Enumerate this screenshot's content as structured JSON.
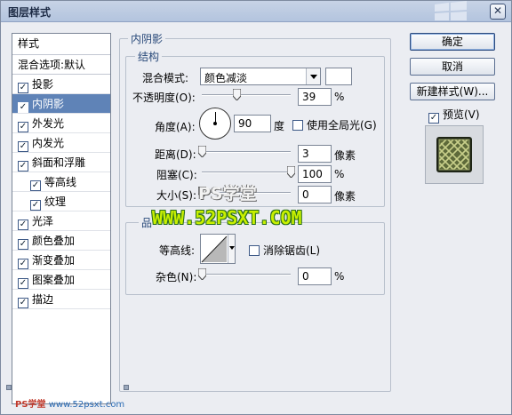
{
  "window": {
    "title": "图层样式"
  },
  "style_list": {
    "header": "样式",
    "blend_options": "混合选项:默认",
    "items": [
      {
        "label": "投影",
        "checked": true,
        "selected": false,
        "indent": false
      },
      {
        "label": "内阴影",
        "checked": true,
        "selected": true,
        "indent": false
      },
      {
        "label": "外发光",
        "checked": true,
        "selected": false,
        "indent": false
      },
      {
        "label": "内发光",
        "checked": true,
        "selected": false,
        "indent": false
      },
      {
        "label": "斜面和浮雕",
        "checked": true,
        "selected": false,
        "indent": false
      },
      {
        "label": "等高线",
        "checked": true,
        "selected": false,
        "indent": true
      },
      {
        "label": "纹理",
        "checked": true,
        "selected": false,
        "indent": true
      },
      {
        "label": "光泽",
        "checked": true,
        "selected": false,
        "indent": false
      },
      {
        "label": "颜色叠加",
        "checked": true,
        "selected": false,
        "indent": false
      },
      {
        "label": "渐变叠加",
        "checked": true,
        "selected": false,
        "indent": false
      },
      {
        "label": "图案叠加",
        "checked": true,
        "selected": false,
        "indent": false
      },
      {
        "label": "描边",
        "checked": true,
        "selected": false,
        "indent": false
      }
    ]
  },
  "inner_shadow": {
    "section_title": "内阴影",
    "structure": {
      "title": "结构",
      "blend_mode_label": "混合模式:",
      "blend_mode_value": "颜色减淡",
      "opacity_label": "不透明度(O):",
      "opacity_value": "39",
      "opacity_unit": "%",
      "opacity_level": 0.39,
      "angle_label": "角度(A):",
      "angle_value": "90",
      "angle_unit": "度",
      "global_light_label": "使用全局光(G)",
      "global_light_checked": false,
      "distance_label": "距离(D):",
      "distance_value": "3",
      "distance_unit": "像素",
      "distance_level": 0.0,
      "choke_label": "阻塞(C):",
      "choke_value": "100",
      "choke_unit": "%",
      "choke_level": 1.0,
      "size_label": "大小(S):",
      "size_value": "0",
      "size_unit": "像素",
      "size_level": 0.0
    },
    "quality": {
      "title": "品",
      "contour_label": "等高线:",
      "antialias_label": "消除锯齿(L)",
      "antialias_checked": false,
      "noise_label": "杂色(N):",
      "noise_value": "0",
      "noise_unit": "%",
      "noise_level": 0.0
    }
  },
  "buttons": {
    "ok": "确定",
    "cancel": "取消",
    "new_style": "新建样式(W)...",
    "preview_label": "预览(V)",
    "preview_checked": true
  },
  "watermarks": {
    "ps_xuetang": "PS学堂",
    "site": "WWW.52PSXT.COM",
    "footer_brand": "PS学堂",
    "footer_site": "www.52psxt.com"
  },
  "colors": {
    "selection": "#5f83b7",
    "accent_label": "#2a4a7a",
    "watermark_green": "#c8f000"
  }
}
